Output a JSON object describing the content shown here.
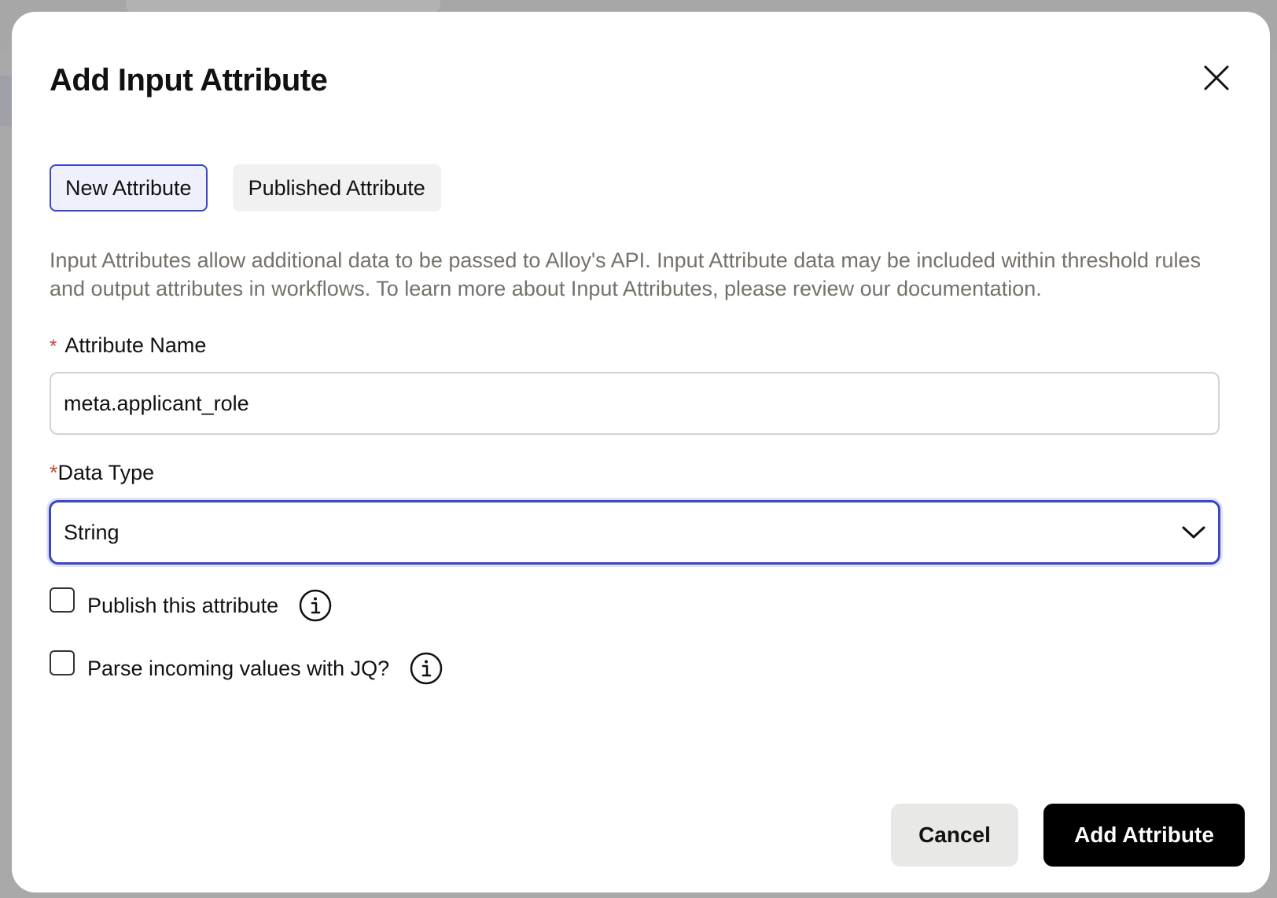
{
  "dialog": {
    "title": "Add Input Attribute",
    "close_icon": "close-icon"
  },
  "tabs": [
    {
      "label": "New Attribute",
      "active": true
    },
    {
      "label": "Published Attribute",
      "active": false
    }
  ],
  "description": "Input Attributes allow additional data to be passed to Alloy's API. Input Attribute data may be included within threshold rules and output attributes in workflows. To learn more about Input Attributes, please review our documentation.",
  "fields": {
    "attribute_name": {
      "required_marker": "*",
      "label": "Attribute Name",
      "value": "meta.applicant_role"
    },
    "data_type": {
      "required_marker": "*",
      "label": "Data Type",
      "value": "String",
      "icon": "chevron-down-icon"
    }
  },
  "checkboxes": [
    {
      "label": "Publish this attribute",
      "checked": false,
      "icon": "info-icon"
    },
    {
      "label": "Parse incoming values with JQ?",
      "checked": false,
      "icon": "info-icon"
    }
  ],
  "actions": {
    "cancel_label": "Cancel",
    "submit_label": "Add Attribute"
  },
  "colors": {
    "accent": "#3a46c8",
    "required": "#c8473a",
    "primary_button": "#000000",
    "secondary_button": "#e8e8e6",
    "muted_text": "#75716a",
    "overlay": "#a9a9aa"
  }
}
